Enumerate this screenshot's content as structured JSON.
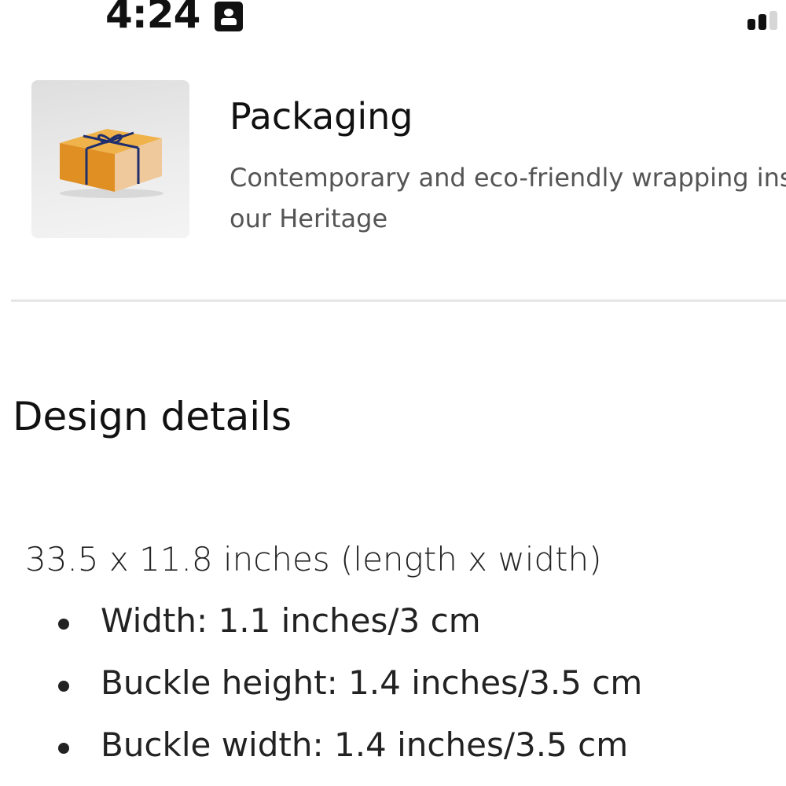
{
  "status_bar": {
    "time": "4:24",
    "badge_icon": "person-badge-icon",
    "signal_icon": "cellular-signal-icon"
  },
  "packaging": {
    "image_icon": "gift-box-icon",
    "title": "Packaging",
    "description_line1": "Contemporary and eco-friendly wrapping ins",
    "description_line2": "our Heritage",
    "box_color": "#e8a23a",
    "ribbon_color": "#1f2f6e"
  },
  "design_details": {
    "title": "Design details",
    "dimensions": "33.5 x 11.8 inches (length x width)",
    "items": [
      {
        "text": "Width: 1.1 inches/3 cm"
      },
      {
        "text": "Buckle height: 1.4 inches/3.5 cm"
      },
      {
        "text": "Buckle width: 1.4 inches/3.5 cm"
      }
    ]
  }
}
